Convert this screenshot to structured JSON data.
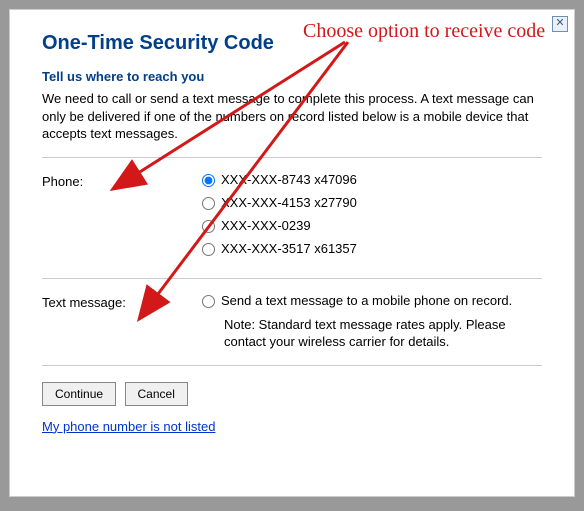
{
  "dialog": {
    "title": "One-Time Security Code",
    "subtitle": "Tell us where to reach you",
    "instructions": "We need to call or send a text message to complete this process. A text message can only be delivered if one of the numbers on record listed below is a mobile device that accepts text messages.",
    "close_glyph": "✕"
  },
  "phone": {
    "label": "Phone:",
    "options": [
      "XXX-XXX-8743 x47096",
      "XXX-XXX-4153 x27790",
      "XXX-XXX-0239",
      "XXX-XXX-3517 x61357"
    ]
  },
  "text_message": {
    "label": "Text message:",
    "option": "Send a text message to a mobile phone on record.",
    "note": "Note: Standard text message rates apply. Please contact your wireless carrier for details."
  },
  "buttons": {
    "continue": "Continue",
    "cancel": "Cancel"
  },
  "link": {
    "not_listed": "My phone number is not listed"
  },
  "annotation": {
    "text": "Choose option to receive code"
  }
}
